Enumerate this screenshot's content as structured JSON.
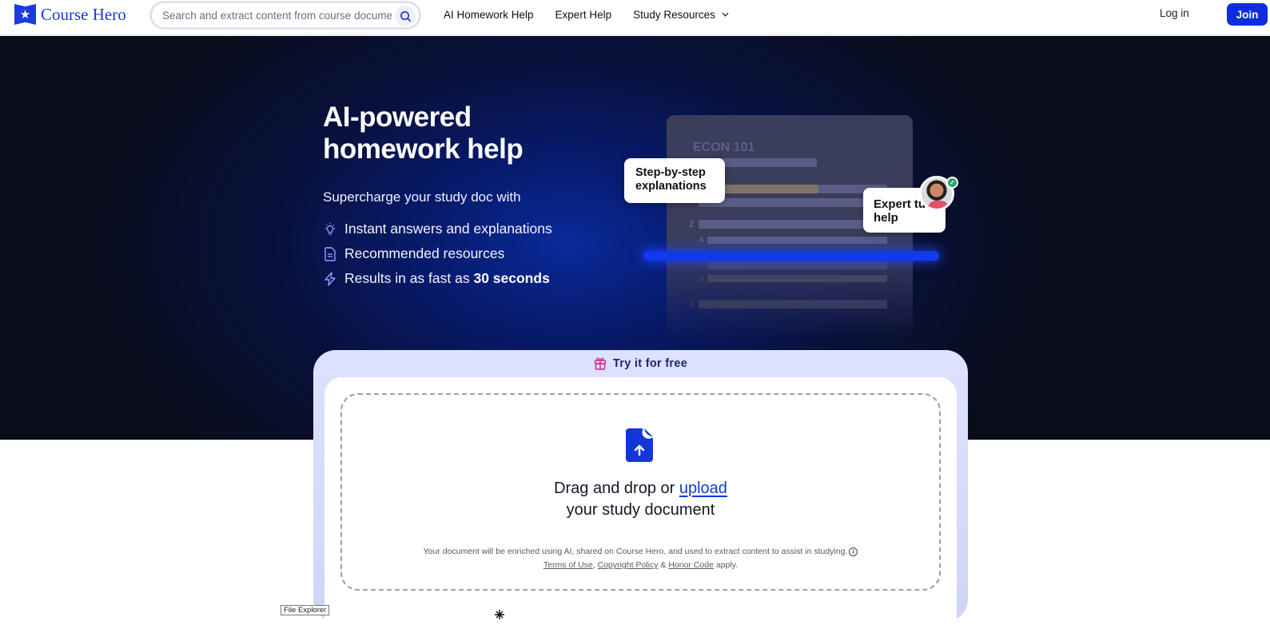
{
  "header": {
    "brand": "Course Hero",
    "search_placeholder": "Search and extract content from course documents, study guides",
    "nav": [
      {
        "label": "AI Homework Help"
      },
      {
        "label": "Expert Help"
      },
      {
        "label": "Study Resources",
        "has_dropdown": true
      }
    ],
    "login_label": "Log in",
    "join_label": "Join"
  },
  "hero": {
    "title": "AI-powered homework help",
    "subtitle": "Supercharge your study doc with",
    "features": [
      {
        "icon": "lightbulb-icon",
        "text": "Instant answers and explanations",
        "bold": ""
      },
      {
        "icon": "document-icon",
        "text": "Recommended resources",
        "bold": ""
      },
      {
        "icon": "lightning-icon",
        "text": "Results in as fast as ",
        "bold": "30 seconds"
      }
    ],
    "illustration": {
      "doc_title": "ECON 101",
      "labels": [
        "2",
        "A",
        "C",
        "D",
        "3"
      ],
      "bubble_step": "Step-by-step explanations",
      "bubble_expert": "Expert tutor help"
    }
  },
  "upload": {
    "promo": "Try it for free",
    "drop_prefix": "Drag and drop or ",
    "drop_link": "upload",
    "drop_suffix": "your study document",
    "disclaimer": "Your document will be enriched using AI, shared on Course Hero, and used to extract content to assist in studying.",
    "terms": "Terms of Use",
    "copyright": "Copyright Policy",
    "amp": " & ",
    "honor": "Honor Code",
    "apply": " apply.",
    "comma": ", "
  },
  "tooltip": "File Explorer",
  "colors": {
    "brand": "#1a3bdf",
    "join": "#0a2ee0",
    "hero_bg": "#0a0d1a",
    "card_bg": "#dde2ff",
    "gift": "#d6248a"
  }
}
